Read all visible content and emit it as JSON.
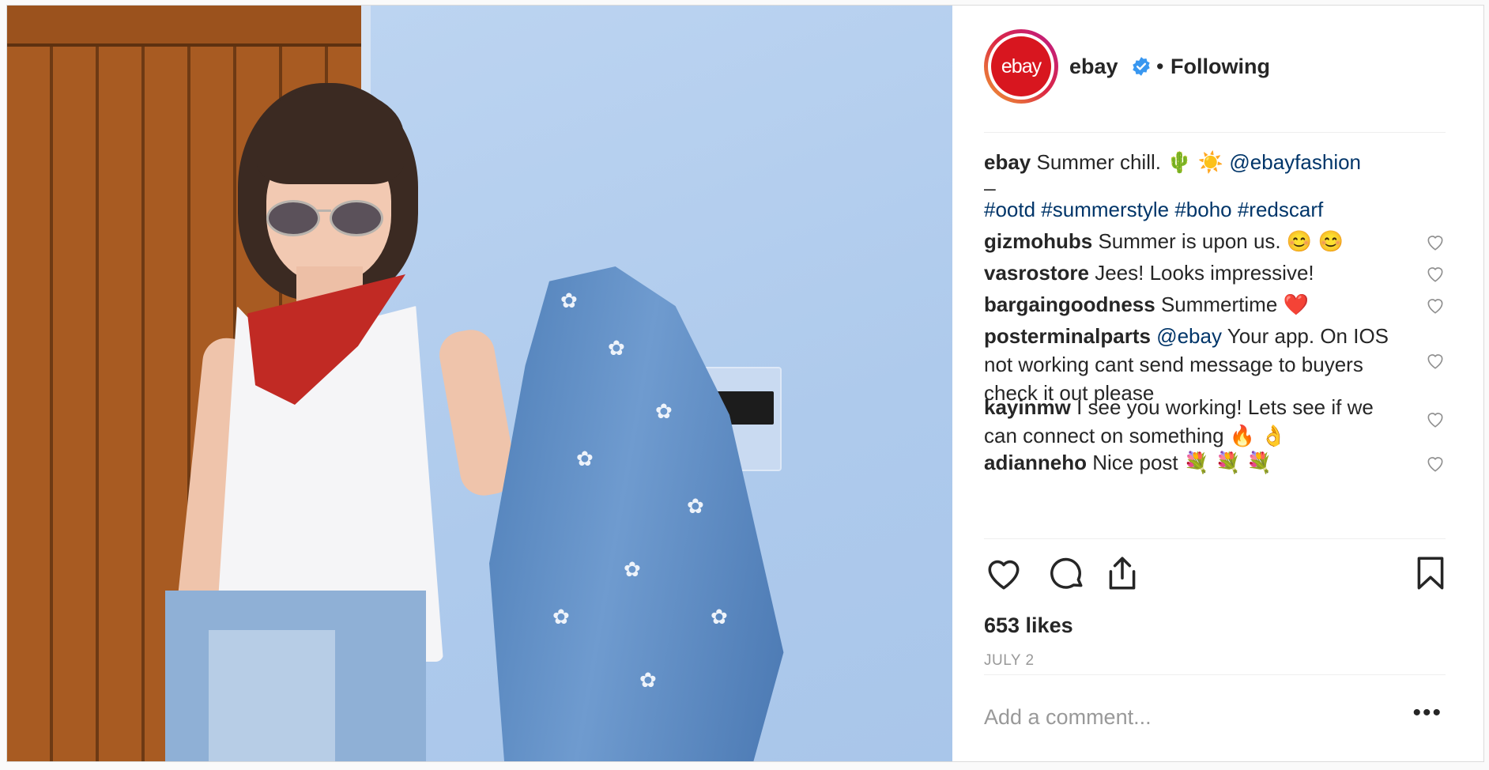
{
  "post": {
    "account": "ebay",
    "avatar_text": "ebay",
    "separator": "•",
    "follow_status": "Following",
    "caption": {
      "user": "ebay",
      "text": "Summer chill. 🌵 ☀️",
      "mention": "@ebayfashion",
      "divider": "_",
      "hashtags": "#ootd #summerstyle #boho #redscarf"
    },
    "comments": [
      {
        "user": "gizmohubs",
        "text": "Summer is upon us. 😊 😊"
      },
      {
        "user": "vasrostore",
        "text": "Jees! Looks impressive!"
      },
      {
        "user": "bargaingoodness",
        "text": "Summertime ❤️"
      },
      {
        "user": "posterminalparts",
        "mention": "@ebay",
        "text": "Your app. On IOS not working cant send message to buyers check it out please"
      },
      {
        "user": "kayinmw",
        "text": "I see you working! Lets see if we can connect on something 🔥 👌"
      },
      {
        "user": "adianneho",
        "text": "Nice post 💐 💐 💐"
      }
    ],
    "likes": "653 likes",
    "date": "JULY 2",
    "add_comment_placeholder": "Add a comment...",
    "more_label": "•••"
  },
  "icons": {
    "like": "heart-icon",
    "comment": "comment-icon",
    "share": "share-icon",
    "save": "bookmark-icon",
    "verified": "verified-badge-icon"
  },
  "colors": {
    "link": "#003569",
    "text": "#262626",
    "muted": "#999999",
    "verified": "#3897f0",
    "brand_red": "#d8161f"
  }
}
